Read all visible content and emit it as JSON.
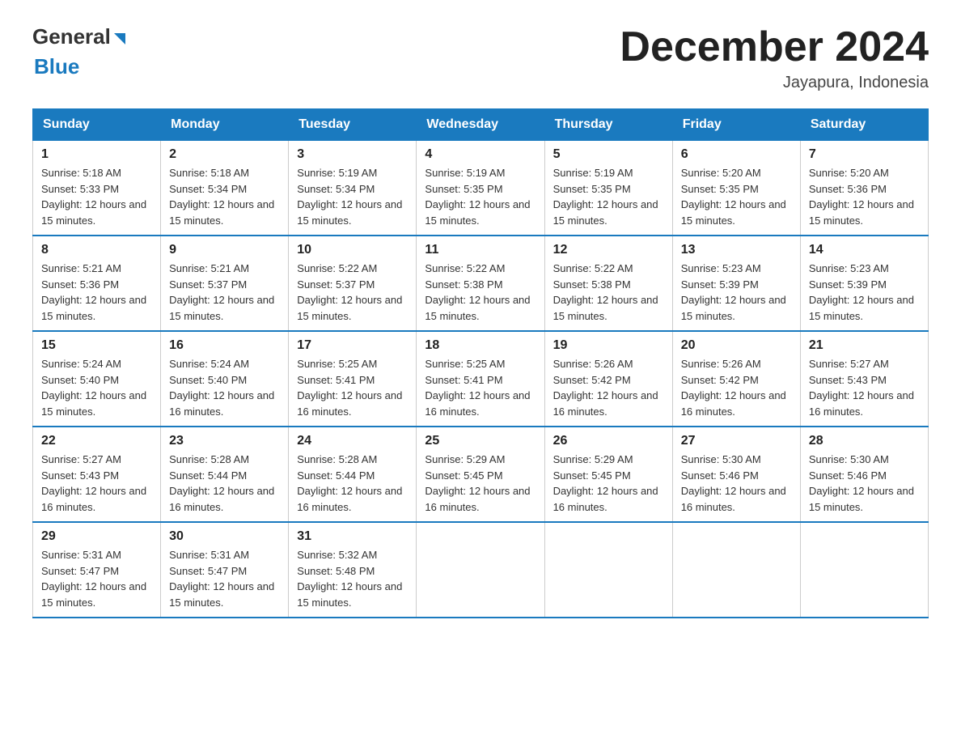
{
  "header": {
    "logo_general": "General",
    "logo_blue": "Blue",
    "title": "December 2024",
    "location": "Jayapura, Indonesia"
  },
  "weekdays": [
    "Sunday",
    "Monday",
    "Tuesday",
    "Wednesday",
    "Thursday",
    "Friday",
    "Saturday"
  ],
  "weeks": [
    [
      {
        "day": "1",
        "sunrise": "5:18 AM",
        "sunset": "5:33 PM",
        "daylight": "12 hours and 15 minutes."
      },
      {
        "day": "2",
        "sunrise": "5:18 AM",
        "sunset": "5:34 PM",
        "daylight": "12 hours and 15 minutes."
      },
      {
        "day": "3",
        "sunrise": "5:19 AM",
        "sunset": "5:34 PM",
        "daylight": "12 hours and 15 minutes."
      },
      {
        "day": "4",
        "sunrise": "5:19 AM",
        "sunset": "5:35 PM",
        "daylight": "12 hours and 15 minutes."
      },
      {
        "day": "5",
        "sunrise": "5:19 AM",
        "sunset": "5:35 PM",
        "daylight": "12 hours and 15 minutes."
      },
      {
        "day": "6",
        "sunrise": "5:20 AM",
        "sunset": "5:35 PM",
        "daylight": "12 hours and 15 minutes."
      },
      {
        "day": "7",
        "sunrise": "5:20 AM",
        "sunset": "5:36 PM",
        "daylight": "12 hours and 15 minutes."
      }
    ],
    [
      {
        "day": "8",
        "sunrise": "5:21 AM",
        "sunset": "5:36 PM",
        "daylight": "12 hours and 15 minutes."
      },
      {
        "day": "9",
        "sunrise": "5:21 AM",
        "sunset": "5:37 PM",
        "daylight": "12 hours and 15 minutes."
      },
      {
        "day": "10",
        "sunrise": "5:22 AM",
        "sunset": "5:37 PM",
        "daylight": "12 hours and 15 minutes."
      },
      {
        "day": "11",
        "sunrise": "5:22 AM",
        "sunset": "5:38 PM",
        "daylight": "12 hours and 15 minutes."
      },
      {
        "day": "12",
        "sunrise": "5:22 AM",
        "sunset": "5:38 PM",
        "daylight": "12 hours and 15 minutes."
      },
      {
        "day": "13",
        "sunrise": "5:23 AM",
        "sunset": "5:39 PM",
        "daylight": "12 hours and 15 minutes."
      },
      {
        "day": "14",
        "sunrise": "5:23 AM",
        "sunset": "5:39 PM",
        "daylight": "12 hours and 15 minutes."
      }
    ],
    [
      {
        "day": "15",
        "sunrise": "5:24 AM",
        "sunset": "5:40 PM",
        "daylight": "12 hours and 15 minutes."
      },
      {
        "day": "16",
        "sunrise": "5:24 AM",
        "sunset": "5:40 PM",
        "daylight": "12 hours and 16 minutes."
      },
      {
        "day": "17",
        "sunrise": "5:25 AM",
        "sunset": "5:41 PM",
        "daylight": "12 hours and 16 minutes."
      },
      {
        "day": "18",
        "sunrise": "5:25 AM",
        "sunset": "5:41 PM",
        "daylight": "12 hours and 16 minutes."
      },
      {
        "day": "19",
        "sunrise": "5:26 AM",
        "sunset": "5:42 PM",
        "daylight": "12 hours and 16 minutes."
      },
      {
        "day": "20",
        "sunrise": "5:26 AM",
        "sunset": "5:42 PM",
        "daylight": "12 hours and 16 minutes."
      },
      {
        "day": "21",
        "sunrise": "5:27 AM",
        "sunset": "5:43 PM",
        "daylight": "12 hours and 16 minutes."
      }
    ],
    [
      {
        "day": "22",
        "sunrise": "5:27 AM",
        "sunset": "5:43 PM",
        "daylight": "12 hours and 16 minutes."
      },
      {
        "day": "23",
        "sunrise": "5:28 AM",
        "sunset": "5:44 PM",
        "daylight": "12 hours and 16 minutes."
      },
      {
        "day": "24",
        "sunrise": "5:28 AM",
        "sunset": "5:44 PM",
        "daylight": "12 hours and 16 minutes."
      },
      {
        "day": "25",
        "sunrise": "5:29 AM",
        "sunset": "5:45 PM",
        "daylight": "12 hours and 16 minutes."
      },
      {
        "day": "26",
        "sunrise": "5:29 AM",
        "sunset": "5:45 PM",
        "daylight": "12 hours and 16 minutes."
      },
      {
        "day": "27",
        "sunrise": "5:30 AM",
        "sunset": "5:46 PM",
        "daylight": "12 hours and 16 minutes."
      },
      {
        "day": "28",
        "sunrise": "5:30 AM",
        "sunset": "5:46 PM",
        "daylight": "12 hours and 15 minutes."
      }
    ],
    [
      {
        "day": "29",
        "sunrise": "5:31 AM",
        "sunset": "5:47 PM",
        "daylight": "12 hours and 15 minutes."
      },
      {
        "day": "30",
        "sunrise": "5:31 AM",
        "sunset": "5:47 PM",
        "daylight": "12 hours and 15 minutes."
      },
      {
        "day": "31",
        "sunrise": "5:32 AM",
        "sunset": "5:48 PM",
        "daylight": "12 hours and 15 minutes."
      },
      null,
      null,
      null,
      null
    ]
  ]
}
